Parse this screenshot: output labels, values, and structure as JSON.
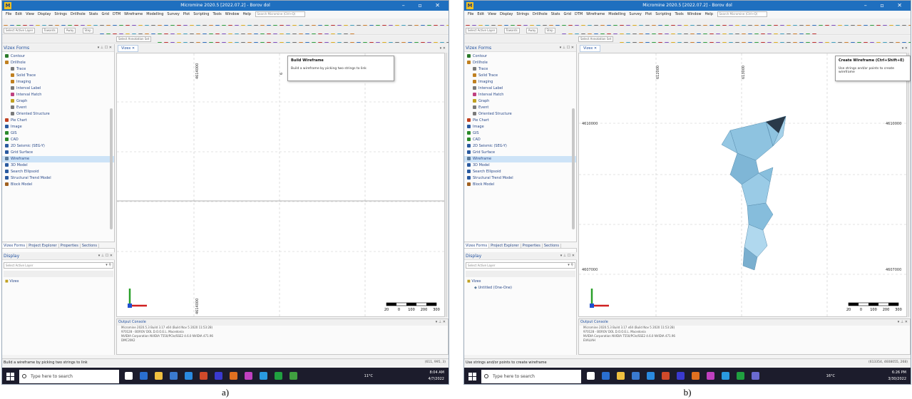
{
  "colors": {
    "titlebar": "#1f6fbf",
    "wireframe_fill": "#8ec3e0",
    "wireframe_edge": "#5a8fb0",
    "axis_x": "#2aa02a",
    "axis_y": "#d02020",
    "axis_z": "#2050d0",
    "taskbar": "#1c1c2c"
  },
  "shared": {
    "app_title": "Micromine 2020.5 [2022.07.2] - Borov dol",
    "menu_items": [
      "File",
      "Edit",
      "View",
      "Display",
      "Strings",
      "Drillhole",
      "Stats",
      "Grid",
      "DTM",
      "Wireframe",
      "Modelling",
      "Survey",
      "Plot",
      "Scripting",
      "Tools",
      "Window",
      "Help"
    ],
    "search_placeholder": "Search Micromine (Ctrl+Q)",
    "select_active_layer": "Select Active Layer",
    "towards_label": "Towards",
    "away_label": "Away",
    "step_label": "Step",
    "annotation_set": "Select Annotation Set",
    "vizex_forms_title": "Vizex Forms",
    "tree_items": [
      {
        "label": "Contour",
        "depth": 1,
        "icon": "contour-icon",
        "color": "#2a7a2a"
      },
      {
        "label": "Drillhole",
        "depth": 1,
        "icon": "drillhole-icon",
        "color": "#c08020"
      },
      {
        "label": "Trace",
        "depth": 2,
        "icon": "trace-icon",
        "color": "#7a7a7a"
      },
      {
        "label": "Solid Trace",
        "depth": 2,
        "icon": "solid-trace-icon",
        "color": "#c08020"
      },
      {
        "label": "Imaging",
        "depth": 2,
        "icon": "imaging-icon",
        "color": "#c08020"
      },
      {
        "label": "Interval Label",
        "depth": 2,
        "icon": "interval-label-icon",
        "color": "#7a7a7a"
      },
      {
        "label": "Interval Hatch",
        "depth": 2,
        "icon": "interval-hatch-icon",
        "color": "#c04080"
      },
      {
        "label": "Graph",
        "depth": 2,
        "icon": "graph-icon",
        "color": "#c0a020"
      },
      {
        "label": "Event",
        "depth": 2,
        "icon": "event-icon",
        "color": "#7a7a7a"
      },
      {
        "label": "Oriented Structure",
        "depth": 2,
        "icon": "oriented-structure-icon",
        "color": "#7a7a7a"
      },
      {
        "label": "Pie Chart",
        "depth": 1,
        "icon": "pie-chart-icon",
        "color": "#c04020"
      },
      {
        "label": "Image",
        "depth": 1,
        "icon": "image-icon",
        "color": "#2a5aa0"
      },
      {
        "label": "GIS",
        "depth": 1,
        "icon": "gis-icon",
        "color": "#2a8a2a"
      },
      {
        "label": "CAD",
        "depth": 1,
        "icon": "cad-icon",
        "color": "#2a8a2a"
      },
      {
        "label": "2D Seismic (SEG-Y)",
        "depth": 1,
        "icon": "seismic-icon",
        "color": "#2a5aa0"
      },
      {
        "label": "Grid Surface",
        "depth": 1,
        "icon": "grid-surface-icon",
        "color": "#2a5aa0"
      },
      {
        "label": "Wireframe",
        "depth": 1,
        "icon": "wireframe-icon",
        "color": "#5a7a9a"
      },
      {
        "label": "3D Model",
        "depth": 1,
        "icon": "model-3d-icon",
        "color": "#2a5aa0"
      },
      {
        "label": "Search Ellipsoid",
        "depth": 1,
        "icon": "search-ellipsoid-icon",
        "color": "#2a5aa0"
      },
      {
        "label": "Structural Trend Model",
        "depth": 1,
        "icon": "trend-model-icon",
        "color": "#2a5aa0"
      },
      {
        "label": "Block Model",
        "depth": 1,
        "icon": "block-model-icon",
        "color": "#a06020"
      }
    ],
    "panel_tabs": [
      "Vizex Forms",
      "Project Explorer",
      "Properties",
      "Sections"
    ],
    "display_title": "Display",
    "display_layer_placeholder": "Select Active Layer",
    "display_root": "Vizex",
    "view_tab": "Vizex",
    "output_console_title": "Output Console",
    "console_lines": [
      "Micromine 2020.5.3 Build 3.17 x64 (Build Nov  5 2020 11:53:28)",
      "970128 - BOROV DOL D.O.O.E.L. Macedonia",
      "NVIDIA Corporation NVIDIA T550/PCIe/SSE2 4.6.0 NVIDIA 471.96"
    ],
    "taskbar_search": "Type here to search",
    "window_controls": "– ▫ ✕"
  },
  "shot_a": {
    "tooltip_title": "Build Wireframe",
    "tooltip_body": "Build a wireframe by picking two strings to link",
    "status": "Build a wireframe by picking two strings to link",
    "coords": "(611, 995, 3)",
    "console_extra": "DMC20K2",
    "weather": "11°C",
    "time": "8:04 AM",
    "date": "4/7/2022",
    "scale_labels": [
      "20",
      "0",
      "100",
      "200",
      "300"
    ],
    "grid_labels": [
      "4614000",
      "4614000",
      "6",
      "E"
    ]
  },
  "shot_b": {
    "tooltip_title": "Create Wireframe (Ctrl+Shift+E)",
    "tooltip_body": "Use strings and/or points to create wireframe",
    "status": "Use strings and/or points to create wireframe",
    "coords": "(613354, 4608055, 268)",
    "console_extra": "EVALIAH",
    "display_child": "Untitled (One-One)",
    "weather": "16°C",
    "time": "6:26 PM",
    "date": "3/30/2022",
    "scale_labels": [
      "20",
      "0",
      "100",
      "200",
      "300"
    ],
    "grid_labels": [
      "4610000",
      "4607000",
      "4610000",
      "4607000",
      "612000",
      "613000"
    ]
  },
  "captions": [
    "a)",
    "b)"
  ]
}
